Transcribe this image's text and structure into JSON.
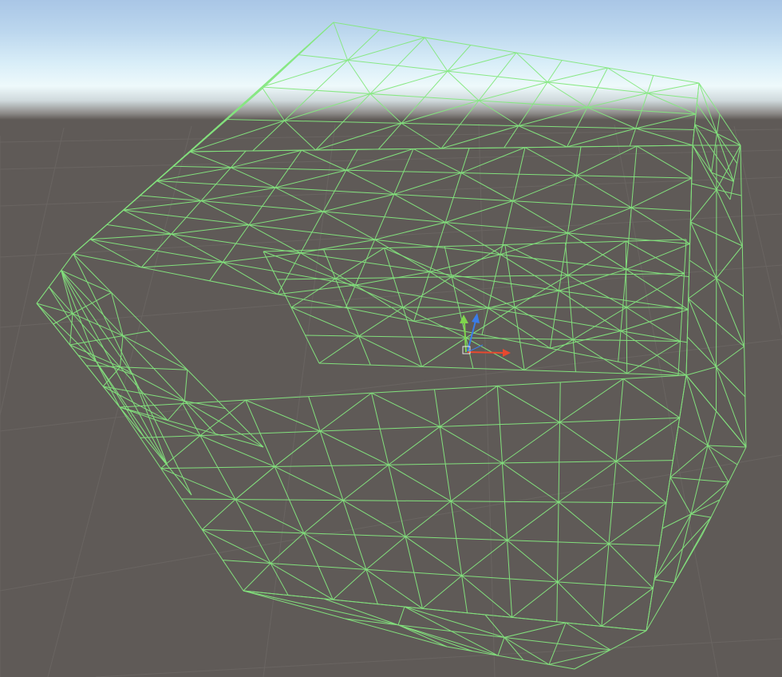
{
  "scene": {
    "view": "scene-view",
    "render_mode": "wireframe",
    "wireframe_color": "#7fe07a",
    "sky_colors": [
      "#a9c6e6",
      "#eef9fb"
    ],
    "ground_color": "#5f5a57",
    "grid_color": "#6b6663"
  },
  "gizmo": {
    "x_axis_color": "#e8492f",
    "y_axis_color": "#7fd64c",
    "z_axis_color": "#3a7ce8"
  }
}
